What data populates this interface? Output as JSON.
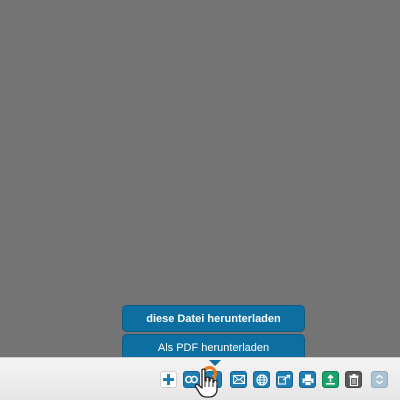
{
  "download_menu": {
    "items": [
      {
        "label": "diese Datei herunterladen"
      },
      {
        "label": "Als PDF herunterladen"
      }
    ]
  },
  "toolbar": {
    "buttons": [
      {
        "name": "add-button",
        "icon": "plus-icon"
      },
      {
        "name": "link-button",
        "icon": "link-icon"
      },
      {
        "name": "download-button",
        "icon": "download-icon"
      },
      {
        "name": "email-button",
        "icon": "envelope-icon"
      },
      {
        "name": "web-button",
        "icon": "globe-icon"
      },
      {
        "name": "share-button",
        "icon": "share-icon"
      },
      {
        "name": "print-button",
        "icon": "printer-icon"
      },
      {
        "name": "upload-button",
        "icon": "upload-icon"
      },
      {
        "name": "delete-button",
        "icon": "trash-icon"
      },
      {
        "name": "expand-button",
        "icon": "chevron-updown-icon"
      }
    ]
  },
  "colors": {
    "menu_bg": "#0d6fa1",
    "active_ring": "#e8791c",
    "button_blue": "#1f7fb3",
    "button_green": "#1aa36a"
  }
}
